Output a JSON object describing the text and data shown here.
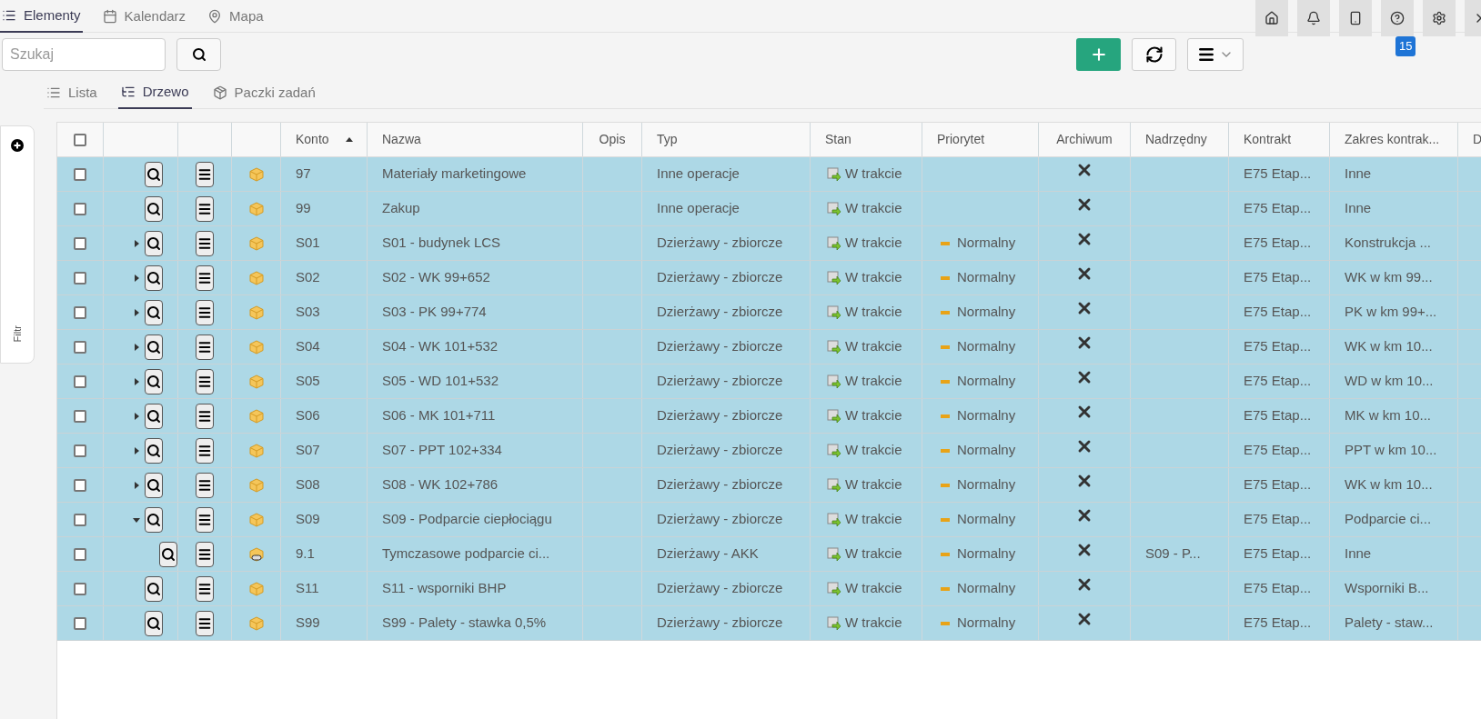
{
  "top_tabs": [
    {
      "label": "Elementy",
      "selected": true
    },
    {
      "label": "Kalendarz",
      "selected": false
    },
    {
      "label": "Mapa",
      "selected": false
    }
  ],
  "help_badge": "15",
  "search": {
    "placeholder": "Szukaj"
  },
  "view_tabs": [
    {
      "label": "Lista",
      "selected": false
    },
    {
      "label": "Drzewo",
      "selected": true
    },
    {
      "label": "Paczki zadań",
      "selected": false
    }
  ],
  "filter_panel": {
    "label": "Filtr"
  },
  "table": {
    "columns": [
      {
        "label": "Konto",
        "sorted": true
      },
      {
        "label": "Nazwa",
        "sorted": false
      },
      {
        "label": "Opis",
        "sorted": false
      },
      {
        "label": "Typ",
        "sorted": false
      },
      {
        "label": "Stan",
        "sorted": false
      },
      {
        "label": "Priorytet",
        "sorted": false
      },
      {
        "label": "Archiwum",
        "sorted": false
      },
      {
        "label": "Nadrzędny",
        "sorted": false
      },
      {
        "label": "Kontrakt",
        "sorted": false
      },
      {
        "label": "Zakres kontrak...",
        "sorted": false
      },
      {
        "label": "D",
        "sorted": false
      }
    ],
    "all_checked": false,
    "rows": [
      {
        "checked": false,
        "selected": true,
        "kind": "package",
        "konto": "97",
        "nazwa": "Materiały marketingowe",
        "typ": "Inne operacje",
        "stan": "W trakcie",
        "archived": false,
        "kontrakt": "E75 Etap...",
        "zakres": "Inne"
      },
      {
        "checked": false,
        "selected": true,
        "kind": "package",
        "konto": "99",
        "nazwa": "Zakup",
        "typ": "Inne operacje",
        "stan": "W trakcie",
        "archived": false,
        "kontrakt": "E75 Etap...",
        "zakres": "Inne"
      },
      {
        "checked": false,
        "selected": true,
        "expanded": false,
        "kind": "package",
        "konto": "S01",
        "nazwa": "S01 - budynek LCS",
        "typ": "Dzierżawy - zbiorcze",
        "stan": "W trakcie",
        "priorytet": "Normalny",
        "archived": false,
        "kontrakt": "E75 Etap...",
        "zakres": "Konstrukcja ..."
      },
      {
        "checked": false,
        "selected": true,
        "expanded": false,
        "kind": "package",
        "konto": "S02",
        "nazwa": "S02 - WK 99+652",
        "typ": "Dzierżawy - zbiorcze",
        "stan": "W trakcie",
        "priorytet": "Normalny",
        "archived": false,
        "kontrakt": "E75 Etap...",
        "zakres": "WK w km 99..."
      },
      {
        "checked": false,
        "selected": true,
        "expanded": false,
        "kind": "package",
        "konto": "S03",
        "nazwa": "S03 - PK 99+774",
        "typ": "Dzierżawy - zbiorcze",
        "stan": "W trakcie",
        "priorytet": "Normalny",
        "archived": false,
        "kontrakt": "E75 Etap...",
        "zakres": "PK w km 99+..."
      },
      {
        "checked": false,
        "selected": true,
        "expanded": false,
        "kind": "package",
        "konto": "S04",
        "nazwa": "S04 - WK 101+532",
        "typ": "Dzierżawy - zbiorcze",
        "stan": "W trakcie",
        "priorytet": "Normalny",
        "archived": false,
        "kontrakt": "E75 Etap...",
        "zakres": "WK w km 10..."
      },
      {
        "checked": false,
        "selected": true,
        "expanded": false,
        "kind": "package",
        "konto": "S05",
        "nazwa": "S05 - WD 101+532",
        "typ": "Dzierżawy - zbiorcze",
        "stan": "W trakcie",
        "priorytet": "Normalny",
        "archived": false,
        "kontrakt": "E75 Etap...",
        "zakres": "WD w km 10..."
      },
      {
        "checked": false,
        "selected": true,
        "expanded": false,
        "kind": "package",
        "konto": "S06",
        "nazwa": "S06 - MK 101+711",
        "typ": "Dzierżawy - zbiorcze",
        "stan": "W trakcie",
        "priorytet": "Normalny",
        "archived": false,
        "kontrakt": "E75 Etap...",
        "zakres": "MK w km 10..."
      },
      {
        "checked": false,
        "selected": true,
        "expanded": false,
        "kind": "package",
        "konto": "S07",
        "nazwa": "S07 - PPT 102+334",
        "typ": "Dzierżawy - zbiorcze",
        "stan": "W trakcie",
        "priorytet": "Normalny",
        "archived": false,
        "kontrakt": "E75 Etap...",
        "zakres": "PPT w km 10..."
      },
      {
        "checked": false,
        "selected": true,
        "expanded": false,
        "kind": "package",
        "konto": "S08",
        "nazwa": "S08 - WK 102+786",
        "typ": "Dzierżawy - zbiorcze",
        "stan": "W trakcie",
        "priorytet": "Normalny",
        "archived": false,
        "kontrakt": "E75 Etap...",
        "zakres": "WK w km 10..."
      },
      {
        "checked": false,
        "selected": true,
        "expanded": true,
        "kind": "package",
        "konto": "S09",
        "nazwa": "S09 - Podparcie ciepłociągu",
        "typ": "Dzierżawy - zbiorcze",
        "stan": "W trakcie",
        "priorytet": "Normalny",
        "archived": false,
        "kontrakt": "E75 Etap...",
        "zakres": "Podparcie ci...",
        "children": [
          {
            "checked": false,
            "selected": true,
            "kind": "linked-package",
            "konto": "9.1",
            "nazwa": "Tymczasowe podparcie ci...",
            "typ": "Dzierżawy - AKK",
            "stan": "W trakcie",
            "priorytet": "Normalny",
            "archived": false,
            "nadrzedny": "S09 - P...",
            "kontrakt": "E75 Etap...",
            "zakres": "Inne"
          }
        ]
      },
      {
        "checked": false,
        "selected": true,
        "kind": "package",
        "konto": "S11",
        "nazwa": "S11 - wsporniki BHP",
        "typ": "Dzierżawy - zbiorcze",
        "stan": "W trakcie",
        "priorytet": "Normalny",
        "archived": false,
        "kontrakt": "E75 Etap...",
        "zakres": "Wsporniki B..."
      },
      {
        "checked": false,
        "selected": true,
        "kind": "package",
        "konto": "S99",
        "nazwa": "S99 - Palety - stawka 0,5%",
        "typ": "Dzierżawy - zbiorcze",
        "stan": "W trakcie",
        "priorytet": "Normalny",
        "archived": false,
        "kontrakt": "E75 Etap...",
        "zakres": "Palety - staw..."
      }
    ]
  }
}
